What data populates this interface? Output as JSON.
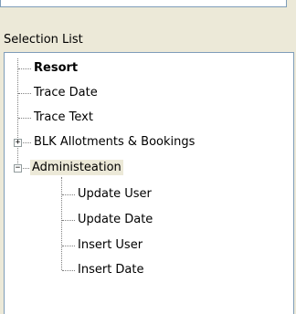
{
  "panel": {
    "label": "Selection List"
  },
  "tree": {
    "items": [
      {
        "label": "Resort",
        "level": 0,
        "bold": true
      },
      {
        "label": "Trace Date",
        "level": 0
      },
      {
        "label": "Trace Text",
        "level": 0
      },
      {
        "label": "BLK  Allotments & Bookings",
        "level": 0,
        "expander": "+"
      },
      {
        "label": "Administeation",
        "level": 0,
        "expander": "−",
        "selected": true
      },
      {
        "label": "Update User",
        "level": 1
      },
      {
        "label": "Update Date",
        "level": 1
      },
      {
        "label": "Insert User",
        "level": 1
      },
      {
        "label": "Insert Date",
        "level": 1
      }
    ]
  }
}
